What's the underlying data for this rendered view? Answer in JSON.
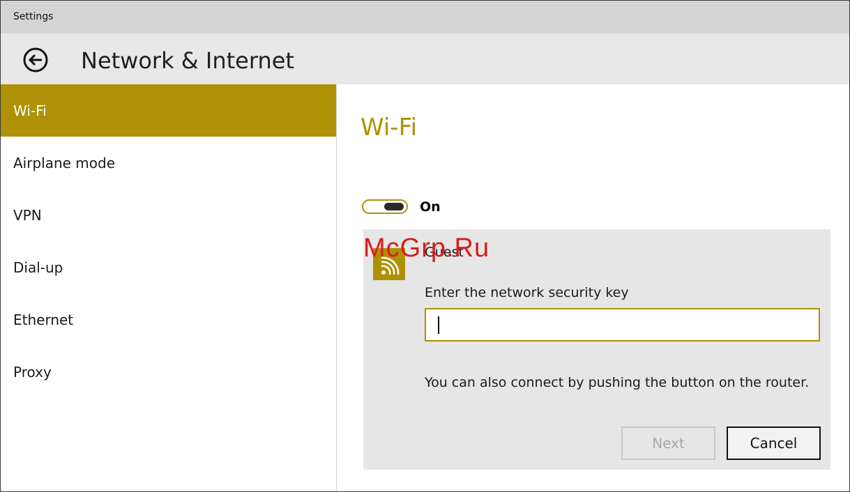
{
  "window": {
    "title": "Settings"
  },
  "header": {
    "title": "Network & Internet",
    "back_icon": "back-arrow-icon"
  },
  "sidebar": {
    "items": [
      {
        "label": "Wi-Fi",
        "selected": true
      },
      {
        "label": "Airplane mode",
        "selected": false
      },
      {
        "label": "VPN",
        "selected": false
      },
      {
        "label": "Dial-up",
        "selected": false
      },
      {
        "label": "Ethernet",
        "selected": false
      },
      {
        "label": "Proxy",
        "selected": false
      }
    ]
  },
  "main": {
    "title": "Wi-Fi",
    "toggle": {
      "label": "On",
      "state": true
    },
    "network": {
      "name": "Guest",
      "icon": "wifi-signal-icon",
      "watermark": "McGrp.Ru",
      "key_label": "Enter the network security key",
      "key_value": "",
      "hint": "You can also connect by pushing the button on the router.",
      "next_label": "Next",
      "cancel_label": "Cancel"
    }
  },
  "colors": {
    "accent": "#ae9105",
    "titlebar": "#d4d4d4",
    "header": "#e8e8e8",
    "card": "#e6e6e6"
  }
}
